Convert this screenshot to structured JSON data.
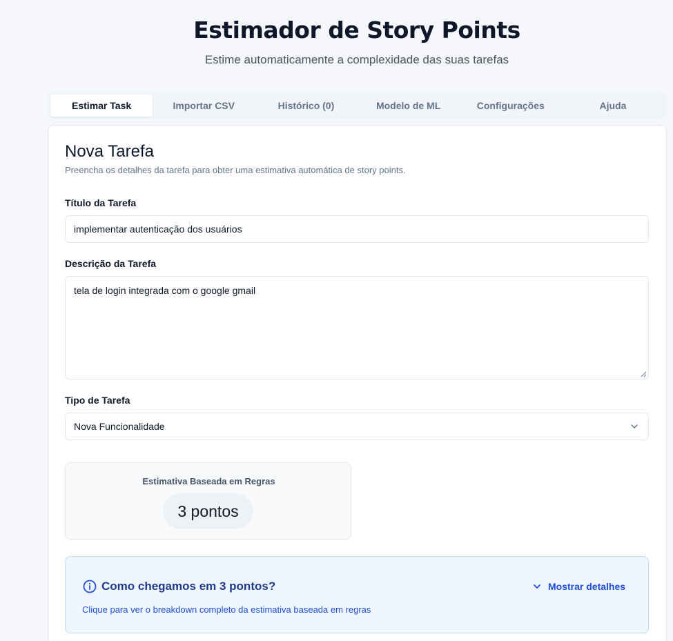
{
  "header": {
    "title": "Estimador de Story Points",
    "subtitle": "Estime automaticamente a complexidade das suas tarefas"
  },
  "tabs": [
    {
      "label": "Estimar Task",
      "active": true
    },
    {
      "label": "Importar CSV",
      "active": false
    },
    {
      "label": "Histórico (0)",
      "active": false
    },
    {
      "label": "Modelo de ML",
      "active": false
    },
    {
      "label": "Configurações",
      "active": false
    },
    {
      "label": "Ajuda",
      "active": false
    }
  ],
  "form": {
    "title": "Nova Tarefa",
    "description": "Preencha os detalhes da tarefa para obter uma estimativa automática de story points.",
    "task_title_label": "Título da Tarefa",
    "task_title_value": "implementar autenticação dos usuários",
    "task_desc_label": "Descrição da Tarefa",
    "task_desc_value": "tela de login integrada com o google gmail",
    "task_type_label": "Tipo de Tarefa",
    "task_type_value": "Nova Funcionalidade"
  },
  "estimate": {
    "label": "Estimativa Baseada em Regras",
    "value": "3 pontos"
  },
  "explanation": {
    "title": "Como chegamos em 3 pontos?",
    "toggle_label": "Mostrar detalhes",
    "description": "Clique para ver o breakdown completo da estimativa baseada em regras"
  },
  "colors": {
    "accent": "#1d4ed8",
    "info_bg": "#eff6ff",
    "text": "#0f172a",
    "muted": "#64748b"
  },
  "icons": {
    "select_chevron": "chevron-down-icon",
    "info": "info-icon",
    "toggle": "chevron-down-icon"
  }
}
